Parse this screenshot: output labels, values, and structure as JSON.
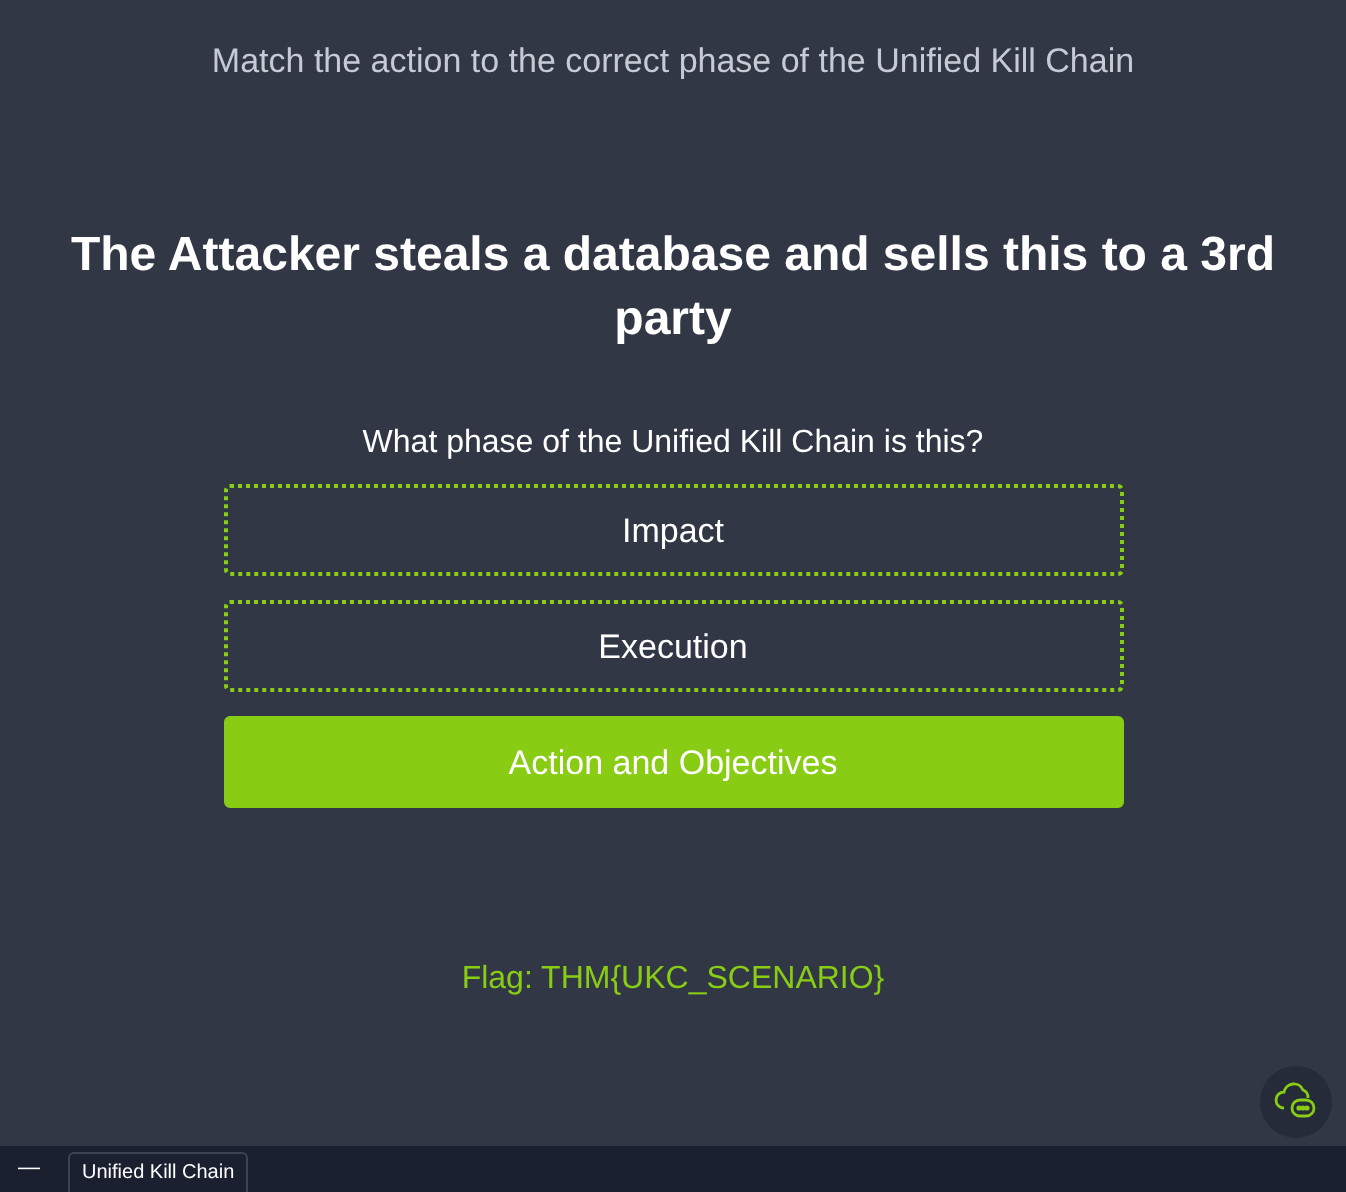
{
  "instruction": "Match the action to the correct phase of the Unified Kill Chain",
  "scenario": "The Attacker steals a database and sells this to a 3rd party",
  "question": "What phase of the Unified Kill Chain is this?",
  "options": [
    {
      "label": "Impact",
      "selected": false
    },
    {
      "label": "Execution",
      "selected": false
    },
    {
      "label": "Action and Objectives",
      "selected": true
    }
  ],
  "flag": "Flag: THM{UKC_SCENARIO}",
  "taskbar": {
    "menu_glyph": "—",
    "tabs": [
      {
        "label": "Unified Kill Chain"
      }
    ]
  }
}
